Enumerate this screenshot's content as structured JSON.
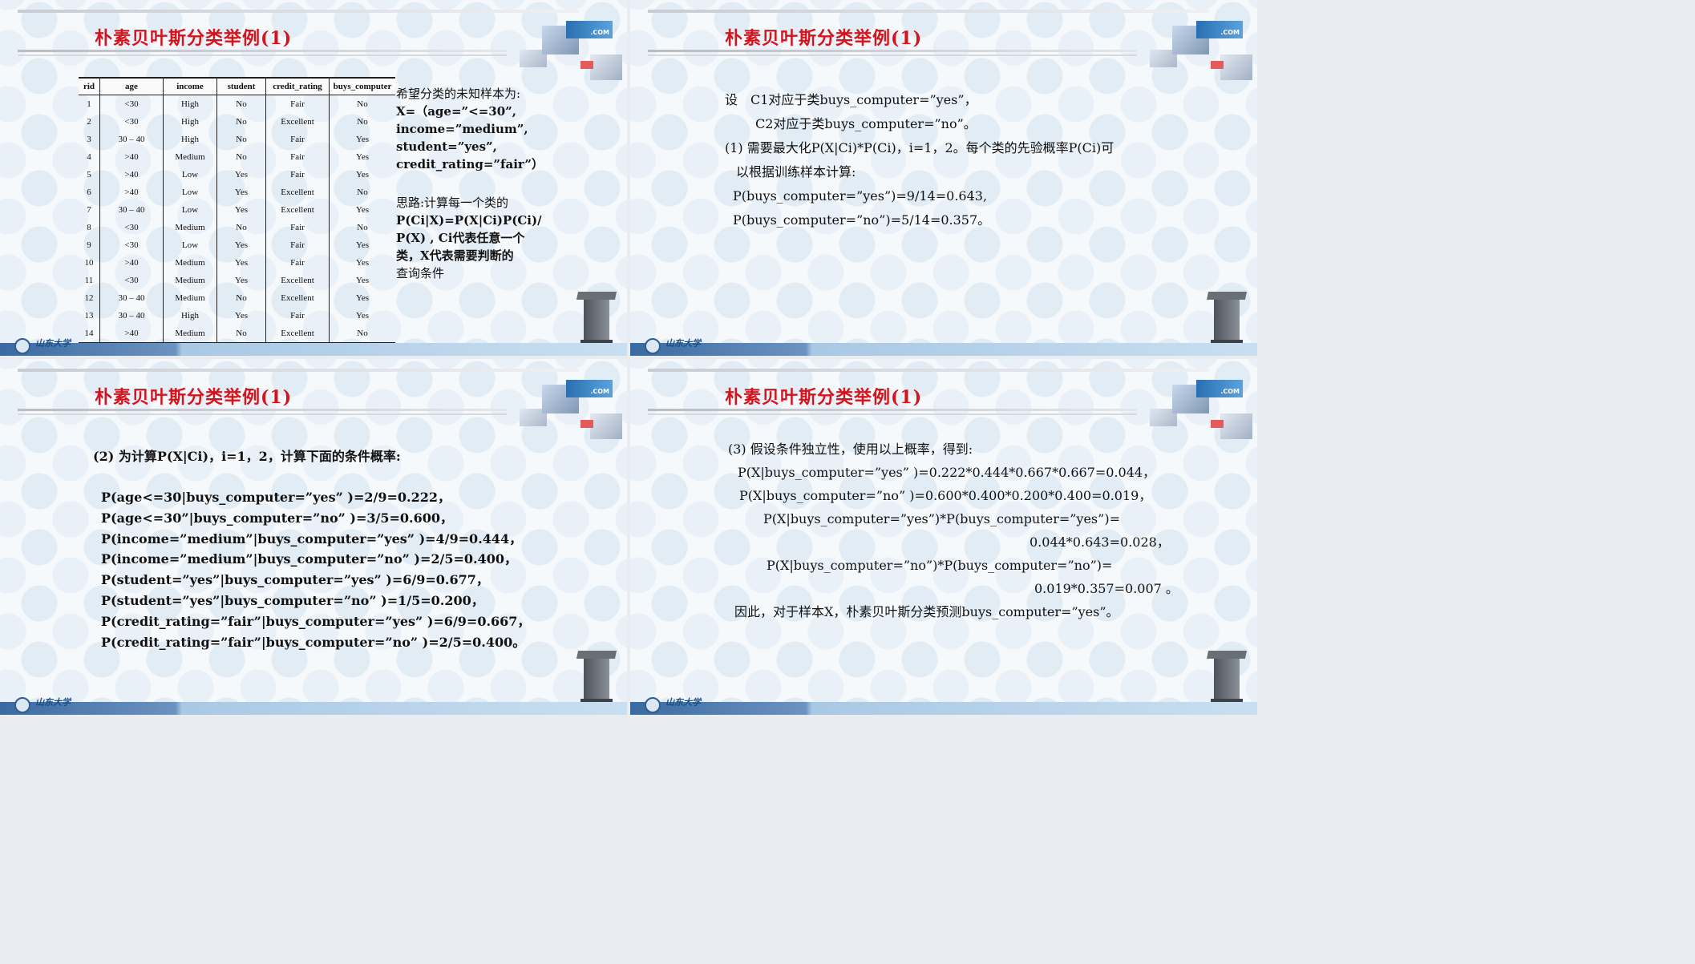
{
  "slide_title": "朴素贝叶斯分类举例(1)",
  "university_name": "山东大学",
  "com_badge": ".COM",
  "slide1": {
    "table": {
      "headers": [
        "rid",
        "age",
        "income",
        "student",
        "credit_rating",
        "buys_computer"
      ],
      "rows": [
        [
          "1",
          "<30",
          "High",
          "No",
          "Fair",
          "No"
        ],
        [
          "2",
          "<30",
          "High",
          "No",
          "Excellent",
          "No"
        ],
        [
          "3",
          "30 – 40",
          "High",
          "No",
          "Fair",
          "Yes"
        ],
        [
          "4",
          ">40",
          "Medium",
          "No",
          "Fair",
          "Yes"
        ],
        [
          "5",
          ">40",
          "Low",
          "Yes",
          "Fair",
          "Yes"
        ],
        [
          "6",
          ">40",
          "Low",
          "Yes",
          "Excellent",
          "No"
        ],
        [
          "7",
          "30 – 40",
          "Low",
          "Yes",
          "Excellent",
          "Yes"
        ],
        [
          "8",
          "<30",
          "Medium",
          "No",
          "Fair",
          "No"
        ],
        [
          "9",
          "<30",
          "Low",
          "Yes",
          "Fair",
          "Yes"
        ],
        [
          "10",
          ">40",
          "Medium",
          "Yes",
          "Fair",
          "Yes"
        ],
        [
          "11",
          "<30",
          "Medium",
          "Yes",
          "Excellent",
          "Yes"
        ],
        [
          "12",
          "30 – 40",
          "Medium",
          "No",
          "Excellent",
          "Yes"
        ],
        [
          "13",
          "30 – 40",
          "High",
          "Yes",
          "Fair",
          "Yes"
        ],
        [
          "14",
          ">40",
          "Medium",
          "No",
          "Excellent",
          "No"
        ]
      ]
    },
    "intro": "希望分类的未知样本为:",
    "sample_lines": [
      "X=（age=”<=30”,",
      "income=”medium”,",
      "student=”yes”,",
      "credit_rating=”fair”）"
    ],
    "idea_lines": [
      "思路:计算每一个类的",
      "P(Ci|X)=P(X|Ci)P(Ci)/",
      "P(X) , Ci代表任意一个",
      "类，X代表需要判断的",
      "查询条件"
    ]
  },
  "slide2": {
    "lines": [
      "设　C1对应于类buys_computer=”yes”，",
      "C2对应于类buys_computer=”no”。",
      "(1)  需要最大化P(X|Ci)*P(Ci)，i=1，2。每个类的先验概率P(Ci)可",
      "以根据训练样本计算:",
      "P(buys_computer=”yes”)=9/14=0.643,",
      "P(buys_computer=”no”)=5/14=0.357。"
    ]
  },
  "slide3": {
    "heading": "(2) 为计算P(X|Ci)，i=1，2，计算下面的条件概率:",
    "lines": [
      "P(age<=30|buys_computer=”yes” )=2/9=0.222，",
      "P(age<=30”|buys_computer=”no” )=3/5=0.600，",
      "P(income=”medium”|buys_computer=”yes” )=4/9=0.444，",
      "P(income=”medium”|buys_computer=”no” )=2/5=0.400，",
      "P(student=”yes”|buys_computer=”yes” )=6/9=0.677，",
      "P(student=”yes”|buys_computer=”no” )=1/5=0.200，",
      "P(credit_rating=”fair”|buys_computer=”yes” )=6/9=0.667，",
      "P(credit_rating=”fair”|buys_computer=”no” )=2/5=0.400。"
    ]
  },
  "slide4": {
    "lines": [
      "(3) 假设条件独立性，使用以上概率，得到:",
      "P(X|buys_computer=”yes” )=0.222*0.444*0.667*0.667=0.044，",
      "P(X|buys_computer=”no” )=0.600*0.400*0.200*0.400=0.019，",
      "P(X|buys_computer=”yes”)*P(buys_computer=”yes”)=",
      "0.044*0.643=0.028，",
      "P(X|buys_computer=”no”)*P(buys_computer=”no”)=",
      "0.019*0.357=0.007 。",
      "因此，对于样本X，朴素贝叶斯分类预测buys_computer=”yes”。"
    ]
  }
}
